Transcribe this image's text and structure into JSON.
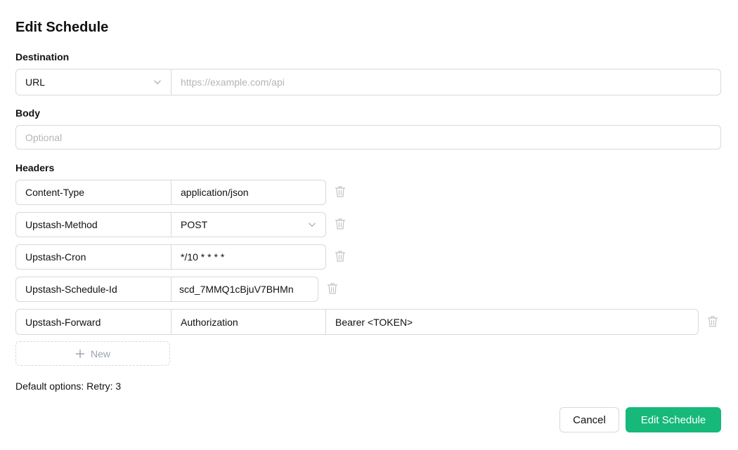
{
  "dialog": {
    "title": "Edit Schedule"
  },
  "destination": {
    "label": "Destination",
    "type_value": "URL",
    "url_placeholder": "https://example.com/api"
  },
  "body": {
    "label": "Body",
    "placeholder": "Optional"
  },
  "headers": {
    "label": "Headers",
    "rows": [
      {
        "key": "Content-Type",
        "value": "application/json"
      },
      {
        "key": "Upstash-Method",
        "value": "POST"
      },
      {
        "key": "Upstash-Cron",
        "value": "*/10 * * * *"
      },
      {
        "key": "Upstash-Schedule-Id",
        "value": "scd_7MMQ1cBjuV7BHMn"
      },
      {
        "key": "Upstash-Forward",
        "name": "Authorization",
        "value": "Bearer <TOKEN>"
      }
    ],
    "new_label": "New"
  },
  "default_options": "Default options: Retry: 3",
  "actions": {
    "cancel": "Cancel",
    "submit": "Edit Schedule"
  },
  "colors": {
    "primary": "#16b97a",
    "border": "#d9d9d9"
  },
  "icons": [
    "chevron-down-icon",
    "trash-icon",
    "plus-icon"
  ]
}
